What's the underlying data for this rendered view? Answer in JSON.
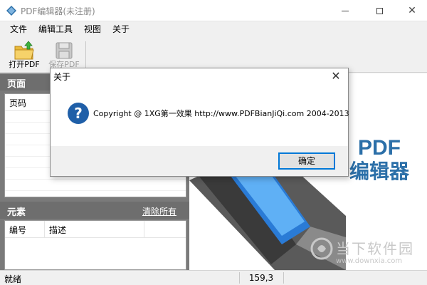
{
  "window": {
    "title": "PDF编辑器(未注册)",
    "close_glyph": "✕"
  },
  "menu": [
    "文件",
    "编辑工具",
    "视图",
    "关于"
  ],
  "toolbar": {
    "open_label": "打开PDF",
    "save_label": "保存PDF"
  },
  "pages_panel": {
    "title": "页面",
    "columns": [
      "页码"
    ]
  },
  "elements_panel": {
    "title": "元素",
    "clear_label": "清除所有",
    "columns": [
      "编号",
      "描述"
    ]
  },
  "canvas": {
    "logo_line1": "PDF",
    "logo_line2": "编辑器",
    "watermark": "当下软件园",
    "watermark_url": "www.downxia.com"
  },
  "status": {
    "text": "就绪",
    "coords": "159,3"
  },
  "dialog": {
    "title": "关于",
    "icon_glyph": "?",
    "message": "Copyright @ 1XG第一效果 http://www.PDFBianJiQi.com 2004-2013",
    "ok_label": "确定"
  },
  "colors": {
    "accent": "#1f5fa8",
    "panel": "#7a7a7a",
    "logo": "#2b6fa8"
  }
}
